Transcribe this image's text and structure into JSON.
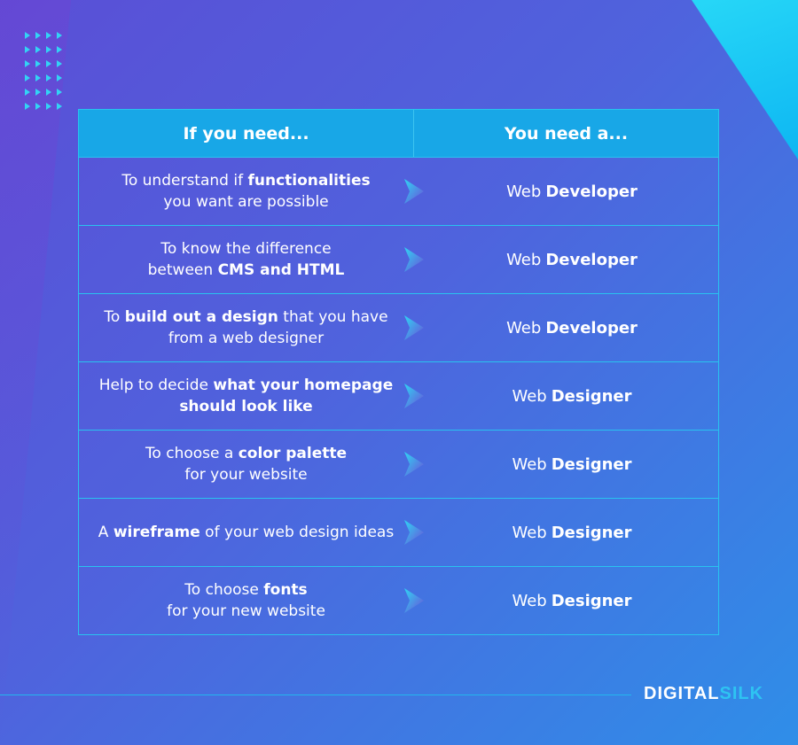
{
  "table": {
    "header_left": "If you need...",
    "header_right": "You need a...",
    "rows": [
      {
        "need_pre": "To understand if ",
        "need_bold": "functionalities",
        "need_post": "you want are possible",
        "role_prefix": "Web",
        "role_bold": "Developer"
      },
      {
        "need_pre": "To know the difference",
        "need_bold": "CMS and HTML",
        "need_post": "between ",
        "role_prefix": "Web",
        "role_bold": "Developer"
      },
      {
        "need_pre": "To ",
        "need_bold": "build out a design",
        "need_post": " that you have from a web designer",
        "role_prefix": "Web",
        "role_bold": "Developer"
      },
      {
        "need_pre": "Help to decide ",
        "need_bold": "what your homepage should look like",
        "need_post": "",
        "role_prefix": "Web",
        "role_bold": "Designer"
      },
      {
        "need_pre": "To choose a ",
        "need_bold": "color palette",
        "need_post": "for your website",
        "role_prefix": "Web",
        "role_bold": "Designer"
      },
      {
        "need_pre": "A ",
        "need_bold": "wireframe",
        "need_post": " of your web design ideas",
        "role_prefix": "Web",
        "role_bold": "Designer"
      },
      {
        "need_pre": "To choose ",
        "need_bold": "fonts",
        "need_post": "for your new website",
        "role_prefix": "Web",
        "role_bold": "Designer"
      }
    ]
  },
  "logo": {
    "part1": "DIGITAL",
    "part2": "SILK"
  },
  "colors": {
    "header": "#18a7e7",
    "border": "#29c3ef",
    "accent": "#2ec3f2"
  },
  "icons": {
    "row_arrow": "arrow-pointer-icon",
    "decoration": "triangle-dots-icon"
  }
}
